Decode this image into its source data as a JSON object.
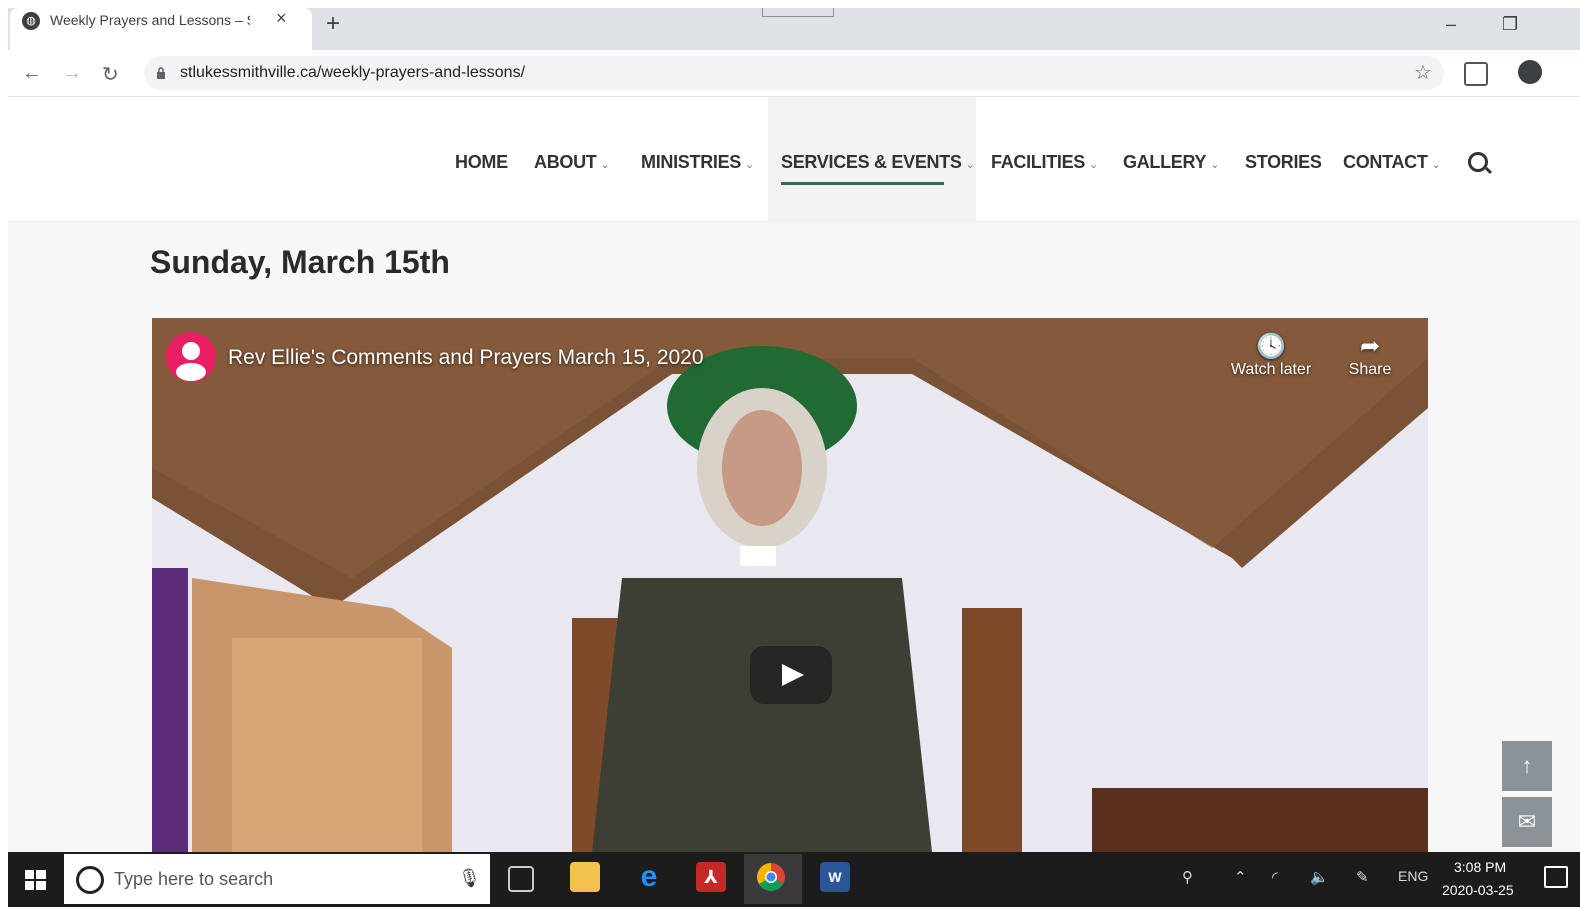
{
  "browser": {
    "tab_title": "Weekly Prayers and Lessons – St.",
    "tab_close": "×",
    "new_tab": "+",
    "minimize": "–",
    "restore": "❐",
    "url": "stlukessmithville.ca/weekly-prayers-and-lessons/",
    "back": "←",
    "forward": "→",
    "reload": "↻",
    "star": "☆"
  },
  "nav": {
    "items": [
      {
        "label": "HOME"
      },
      {
        "label": "ABOUT"
      },
      {
        "label": "MINISTRIES"
      },
      {
        "label": "SERVICES & EVENTS"
      },
      {
        "label": "FACILITIES"
      },
      {
        "label": "GALLERY"
      },
      {
        "label": "STORIES"
      },
      {
        "label": "CONTACT"
      }
    ],
    "caret": "⌄",
    "active": "SERVICES & EVENTS",
    "accent_color": "#2e6b5a"
  },
  "page": {
    "heading": "Sunday, March 15th"
  },
  "video": {
    "title": "Rev Ellie's Comments and Prayers March 15, 2020",
    "watch_later": "Watch later",
    "share": "Share",
    "watch_later_icon": "🕓",
    "share_icon": "➦"
  },
  "side_buttons": {
    "scroll_top": "↑",
    "email": "✉"
  },
  "taskbar": {
    "search_placeholder": "Type here to search",
    "lang": "ENG",
    "time": "3:08 PM",
    "date": "2020-03-25",
    "edge_label": "e",
    "word_label": "W"
  }
}
